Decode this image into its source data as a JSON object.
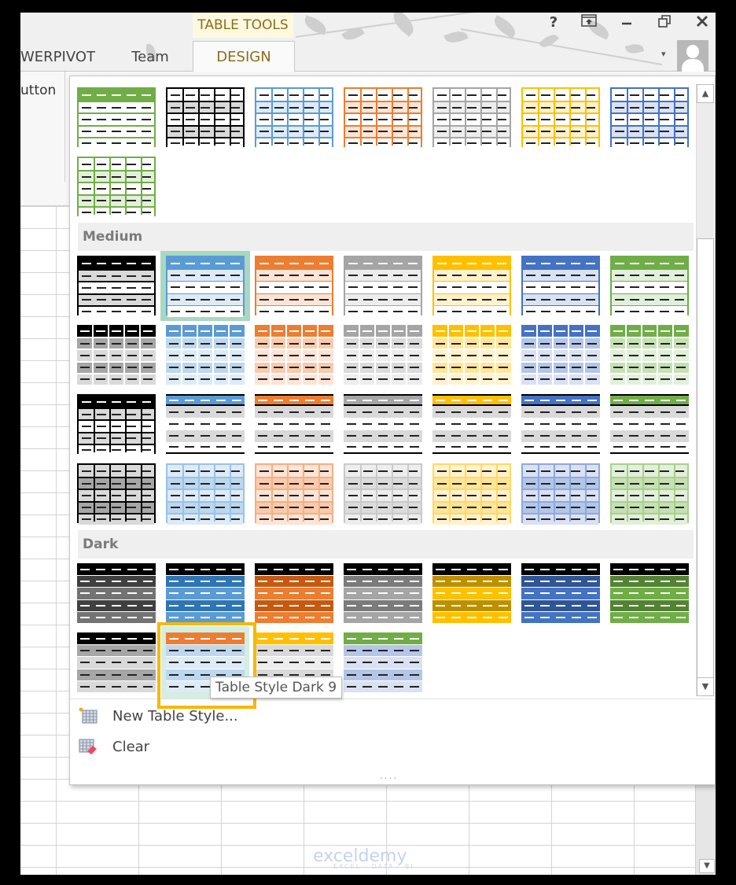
{
  "ribbon": {
    "context_label": "TABLE TOOLS",
    "tabs": [
      {
        "label": "WERPIVOT",
        "active": false
      },
      {
        "label": "Team",
        "active": false
      },
      {
        "label": "DESIGN",
        "active": true
      }
    ],
    "partial_button_text": "utton",
    "window_controls": [
      {
        "name": "help",
        "glyph": "?"
      },
      {
        "name": "ribbon-display-options",
        "glyph": "⬒"
      },
      {
        "name": "minimize",
        "glyph": "—"
      },
      {
        "name": "restore",
        "glyph": "❐"
      },
      {
        "name": "close",
        "glyph": "✕"
      }
    ],
    "account_dropdown_glyph": "▾"
  },
  "gallery": {
    "sections": [
      {
        "title": "Medium"
      },
      {
        "title": "Dark"
      }
    ],
    "light_partial": [
      {
        "name": "Light 15",
        "type": "headerband",
        "color": "#70ad47",
        "band": "#ffffff"
      },
      {
        "name": "Light 16",
        "type": "grid",
        "color": "#000000",
        "band": "#d9d9d9"
      },
      {
        "name": "Light 17",
        "type": "grid",
        "color": "#5b9bd5",
        "band": "#ddebf7"
      },
      {
        "name": "Light 18",
        "type": "grid",
        "color": "#ed7d31",
        "band": "#fce4d6"
      },
      {
        "name": "Light 19",
        "type": "grid",
        "color": "#a5a5a5",
        "band": "#ededed"
      },
      {
        "name": "Light 20",
        "type": "grid",
        "color": "#ffc000",
        "band": "#fff2cc"
      },
      {
        "name": "Light 21",
        "type": "grid",
        "color": "#4472c4",
        "band": "#d9e1f2"
      },
      {
        "name": "Light 22",
        "type": "grid",
        "color": "#70ad47",
        "band": "#e2efda"
      }
    ],
    "medium": [
      {
        "name": "Medium 1",
        "type": "rowbox",
        "color": "#000000",
        "band": "#d9d9d9"
      },
      {
        "name": "Medium 2",
        "type": "rowbox",
        "color": "#5b9bd5",
        "band": "#ddebf7",
        "selected": true
      },
      {
        "name": "Medium 3",
        "type": "rowbox",
        "color": "#ed7d31",
        "band": "#fce4d6"
      },
      {
        "name": "Medium 4",
        "type": "rowbox",
        "color": "#a5a5a5",
        "band": "#ededed"
      },
      {
        "name": "Medium 5",
        "type": "rowbox",
        "color": "#ffc000",
        "band": "#fff2cc"
      },
      {
        "name": "Medium 6",
        "type": "rowbox",
        "color": "#4472c4",
        "band": "#d9e1f2"
      },
      {
        "name": "Medium 7",
        "type": "rowbox",
        "color": "#70ad47",
        "band": "#e2efda"
      },
      {
        "name": "Medium 8",
        "type": "cellfill",
        "color": "#000000",
        "band": "#a6a6a6",
        "band2": "#d9d9d9"
      },
      {
        "name": "Medium 9",
        "type": "cellfill",
        "color": "#5b9bd5",
        "band": "#bdd7ee",
        "band2": "#ddebf7"
      },
      {
        "name": "Medium 10",
        "type": "cellfill",
        "color": "#ed7d31",
        "band": "#f8cbad",
        "band2": "#fce4d6"
      },
      {
        "name": "Medium 11",
        "type": "cellfill",
        "color": "#a5a5a5",
        "band": "#dbdbdb",
        "band2": "#ededed"
      },
      {
        "name": "Medium 12",
        "type": "cellfill",
        "color": "#ffc000",
        "band": "#ffe699",
        "band2": "#fff2cc"
      },
      {
        "name": "Medium 13",
        "type": "cellfill",
        "color": "#4472c4",
        "band": "#b4c6e7",
        "band2": "#d9e1f2"
      },
      {
        "name": "Medium 14",
        "type": "cellfill",
        "color": "#70ad47",
        "band": "#c6e0b4",
        "band2": "#e2efda"
      },
      {
        "name": "Medium 15",
        "type": "blackgrid",
        "color": "#000000",
        "band": "#d9d9d9"
      },
      {
        "name": "Medium 16",
        "type": "lined",
        "color": "#5b9bd5",
        "band": "#d9d9d9"
      },
      {
        "name": "Medium 17",
        "type": "lined",
        "color": "#ed7d31",
        "band": "#d9d9d9"
      },
      {
        "name": "Medium 18",
        "type": "lined",
        "color": "#a5a5a5",
        "band": "#d9d9d9"
      },
      {
        "name": "Medium 19",
        "type": "lined",
        "color": "#ffc000",
        "band": "#d9d9d9"
      },
      {
        "name": "Medium 20",
        "type": "lined",
        "color": "#4472c4",
        "band": "#d9d9d9"
      },
      {
        "name": "Medium 21",
        "type": "lined",
        "color": "#70ad47",
        "band": "#d9d9d9"
      },
      {
        "name": "Medium 22",
        "type": "softgrid",
        "color": "#000000",
        "band": "#a6a6a6",
        "band2": "#d9d9d9",
        "line": "#000000"
      },
      {
        "name": "Medium 23",
        "type": "softgrid",
        "color": "#9bc2e6",
        "band": "#bdd7ee",
        "band2": "#ddebf7",
        "line": "#9bc2e6"
      },
      {
        "name": "Medium 24",
        "type": "softgrid",
        "color": "#f4b084",
        "band": "#f8cbad",
        "band2": "#fce4d6",
        "line": "#f4b084"
      },
      {
        "name": "Medium 25",
        "type": "softgrid",
        "color": "#c9c9c9",
        "band": "#dbdbdb",
        "band2": "#ededed",
        "line": "#c9c9c9"
      },
      {
        "name": "Medium 26",
        "type": "softgrid",
        "color": "#ffd966",
        "band": "#ffe699",
        "band2": "#fff2cc",
        "line": "#ffd966"
      },
      {
        "name": "Medium 27",
        "type": "softgrid",
        "color": "#8ea9db",
        "band": "#b4c6e7",
        "band2": "#d9e1f2",
        "line": "#8ea9db"
      },
      {
        "name": "Medium 28",
        "type": "softgrid",
        "color": "#a9d08e",
        "band": "#c6e0b4",
        "band2": "#e2efda",
        "line": "#a9d08e"
      }
    ],
    "dark": [
      {
        "name": "Dark 1",
        "type": "dark",
        "color": "#000000",
        "band": "#404040",
        "band2": "#737373"
      },
      {
        "name": "Dark 2",
        "type": "dark",
        "color": "#000000",
        "band": "#2f75b5",
        "band2": "#5b9bd5"
      },
      {
        "name": "Dark 3",
        "type": "dark",
        "color": "#000000",
        "band": "#c65911",
        "band2": "#ed7d31"
      },
      {
        "name": "Dark 4",
        "type": "dark",
        "color": "#000000",
        "band": "#7b7b7b",
        "band2": "#a5a5a5"
      },
      {
        "name": "Dark 5",
        "type": "dark",
        "color": "#000000",
        "band": "#bf8f00",
        "band2": "#ffc000"
      },
      {
        "name": "Dark 6",
        "type": "dark",
        "color": "#000000",
        "band": "#305496",
        "band2": "#4472c4"
      },
      {
        "name": "Dark 7",
        "type": "dark",
        "color": "#000000",
        "band": "#548235",
        "band2": "#70ad47"
      },
      {
        "name": "Dark 8",
        "type": "darklight",
        "color": "#000000",
        "band": "#a6a6a6",
        "band2": "#d9d9d9"
      },
      {
        "name": "Dark 9",
        "type": "darklight",
        "color": "#ed7d31",
        "band": "#bdd7ee",
        "band2": "#ddebf7",
        "hovered": true
      },
      {
        "name": "Dark 10",
        "type": "darklight",
        "color": "#ffc000",
        "band": "#d9d9d9",
        "band2": "#ededed"
      },
      {
        "name": "Dark 11",
        "type": "darklight",
        "color": "#70ad47",
        "band": "#b4c6e7",
        "band2": "#d9e1f2"
      }
    ],
    "tooltip": "Table Style Dark 9",
    "menu": [
      {
        "label": "New Table Style...",
        "icon": "new-table-style-icon"
      },
      {
        "label": "Clear",
        "icon": "clear-icon"
      }
    ],
    "resize_grip": "....",
    "colors": {
      "selected_frame": "#a8d8c0",
      "hover_frame": "#f6b800"
    }
  },
  "watermark": {
    "brand": "exceldemy",
    "tagline": "EXCEL · DATA · BI"
  }
}
